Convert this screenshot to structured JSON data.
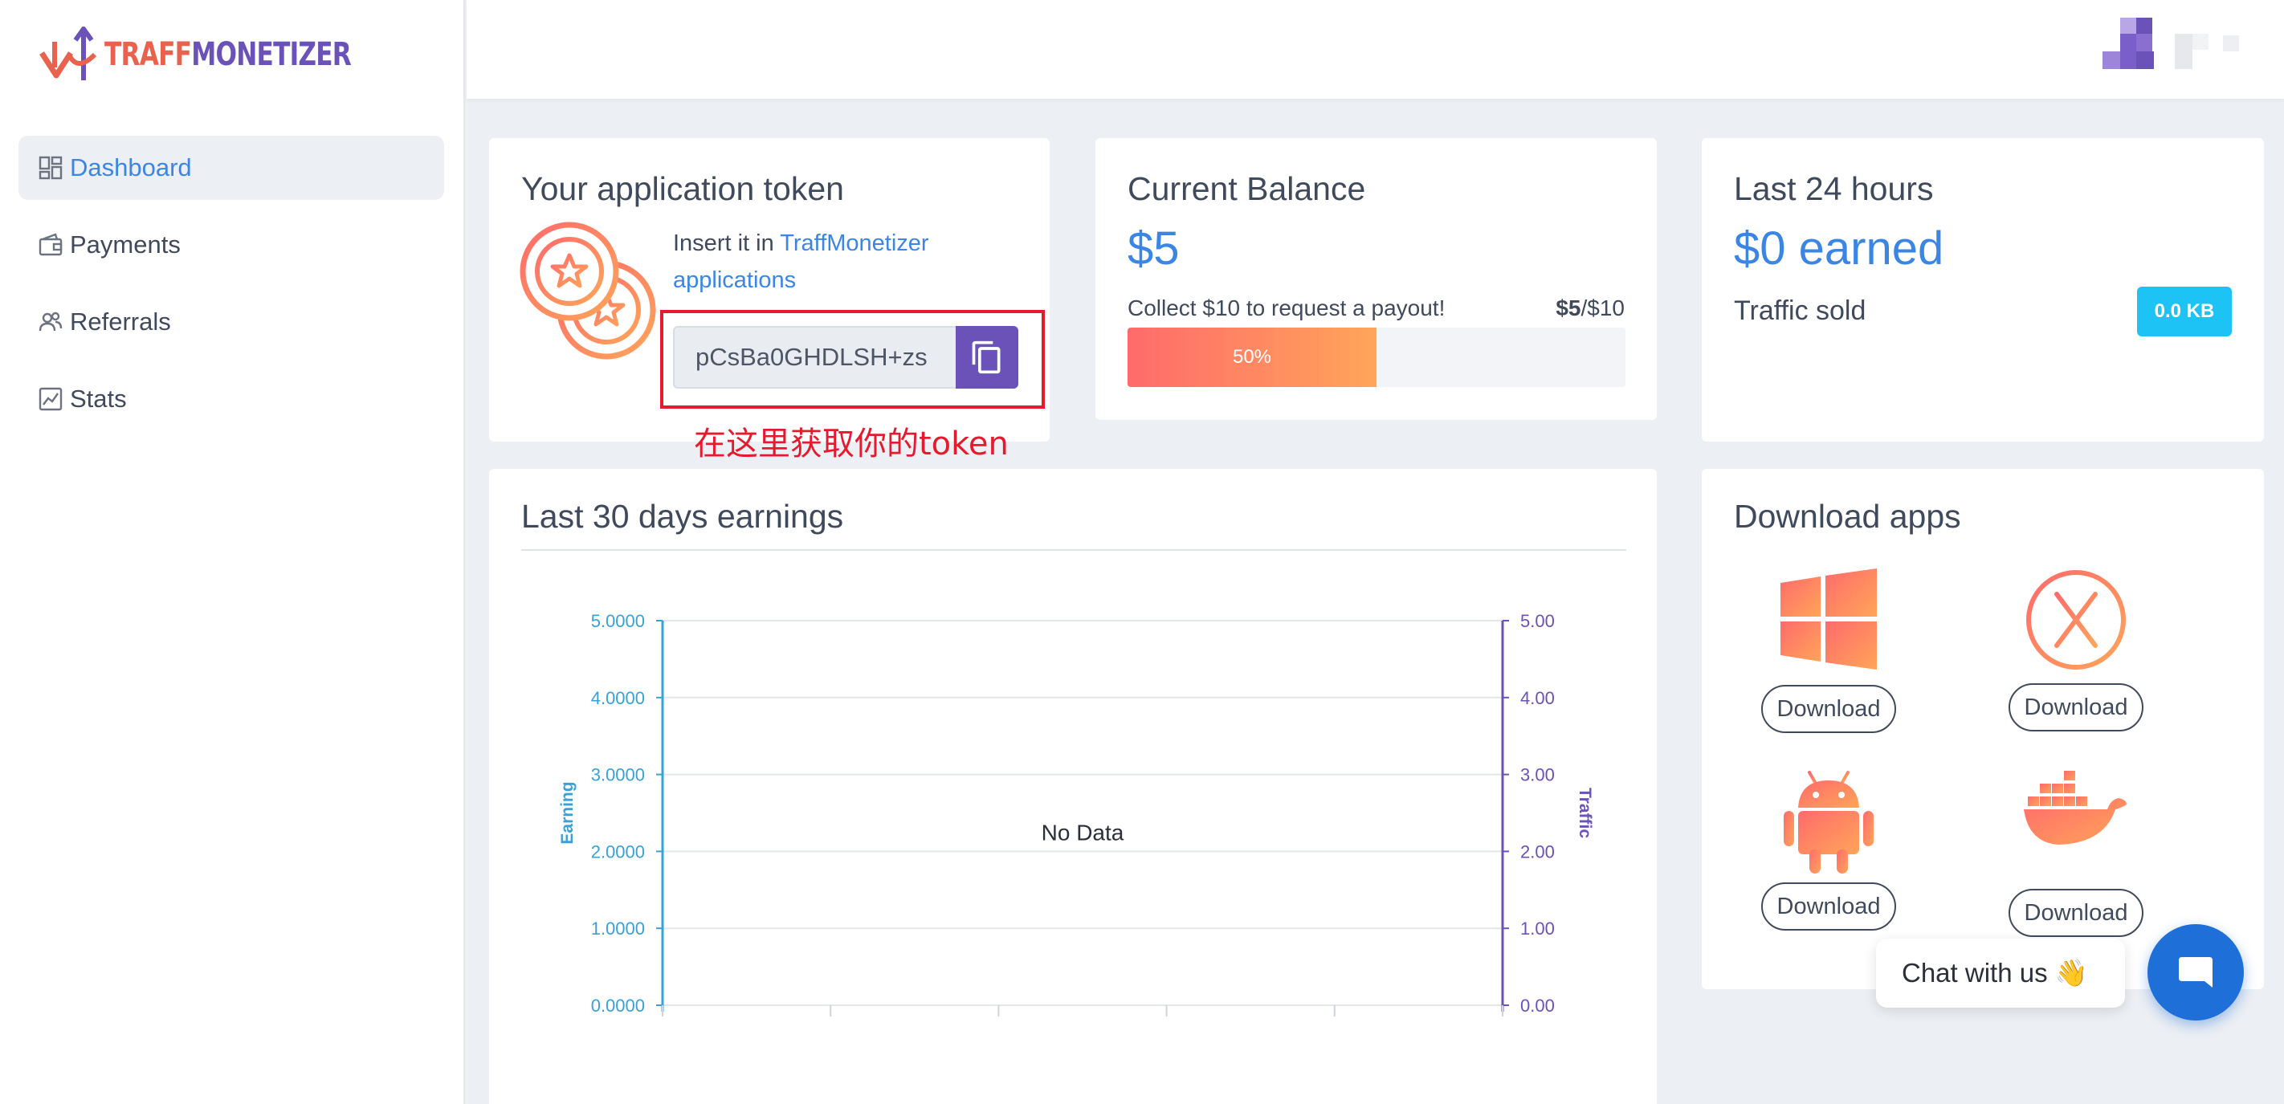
{
  "brand": {
    "name_part1": "TRAFF",
    "name_part2": "MONETIZER"
  },
  "sidebar": {
    "items": [
      {
        "label": "Dashboard",
        "icon": "dashboard-icon",
        "active": true
      },
      {
        "label": "Payments",
        "icon": "wallet-icon",
        "active": false
      },
      {
        "label": "Referrals",
        "icon": "users-icon",
        "active": false
      },
      {
        "label": "Stats",
        "icon": "chart-icon",
        "active": false
      }
    ]
  },
  "token_card": {
    "title": "Your application token",
    "insert_prefix": "Insert it in ",
    "insert_link": "TraffMonetizer applications",
    "token_value": "pCsBa0GHDLSH+zs",
    "annotation": "在这里获取你的token"
  },
  "balance_card": {
    "title": "Current Balance",
    "amount": "$5",
    "collect_text": "Collect $10 to request a payout!",
    "ratio_current": "$5",
    "ratio_target": "/$10",
    "progress_label": "50%",
    "progress_fraction": 0.5
  },
  "h24_card": {
    "title": "Last 24 hours",
    "earned": "$0 earned",
    "traffic_label": "Traffic sold",
    "traffic_value": "0.0 KB"
  },
  "chart_card": {
    "title": "Last 30 days earnings"
  },
  "chart_data": {
    "type": "line",
    "no_data_text": "No Data",
    "ylabel": "Earning",
    "y2label": "Traffic",
    "ylim": [
      0,
      5
    ],
    "y2lim": [
      0,
      5
    ],
    "y_ticks": [
      "0.0000",
      "1.0000",
      "2.0000",
      "3.0000",
      "4.0000",
      "5.0000"
    ],
    "y2_ticks": [
      "0.00",
      "1.00",
      "2.00",
      "3.00",
      "4.00",
      "5.00"
    ],
    "series": [],
    "grid": true,
    "colors": {
      "left_axis": "#3aa0d8",
      "right_axis": "#6b52b8"
    }
  },
  "apps_card": {
    "title": "Download apps",
    "apps": [
      {
        "icon": "windows-icon",
        "button": "Download"
      },
      {
        "icon": "macos-icon",
        "button": "Download"
      },
      {
        "icon": "android-icon",
        "button": "Download"
      },
      {
        "icon": "docker-icon",
        "button": "Download"
      }
    ]
  },
  "chat": {
    "label": "Chat with us 👋"
  },
  "colors": {
    "accent": "#3b86e4",
    "purple": "#6b52b8",
    "orange": "#ff7a59",
    "badge": "#1ec3f5"
  }
}
